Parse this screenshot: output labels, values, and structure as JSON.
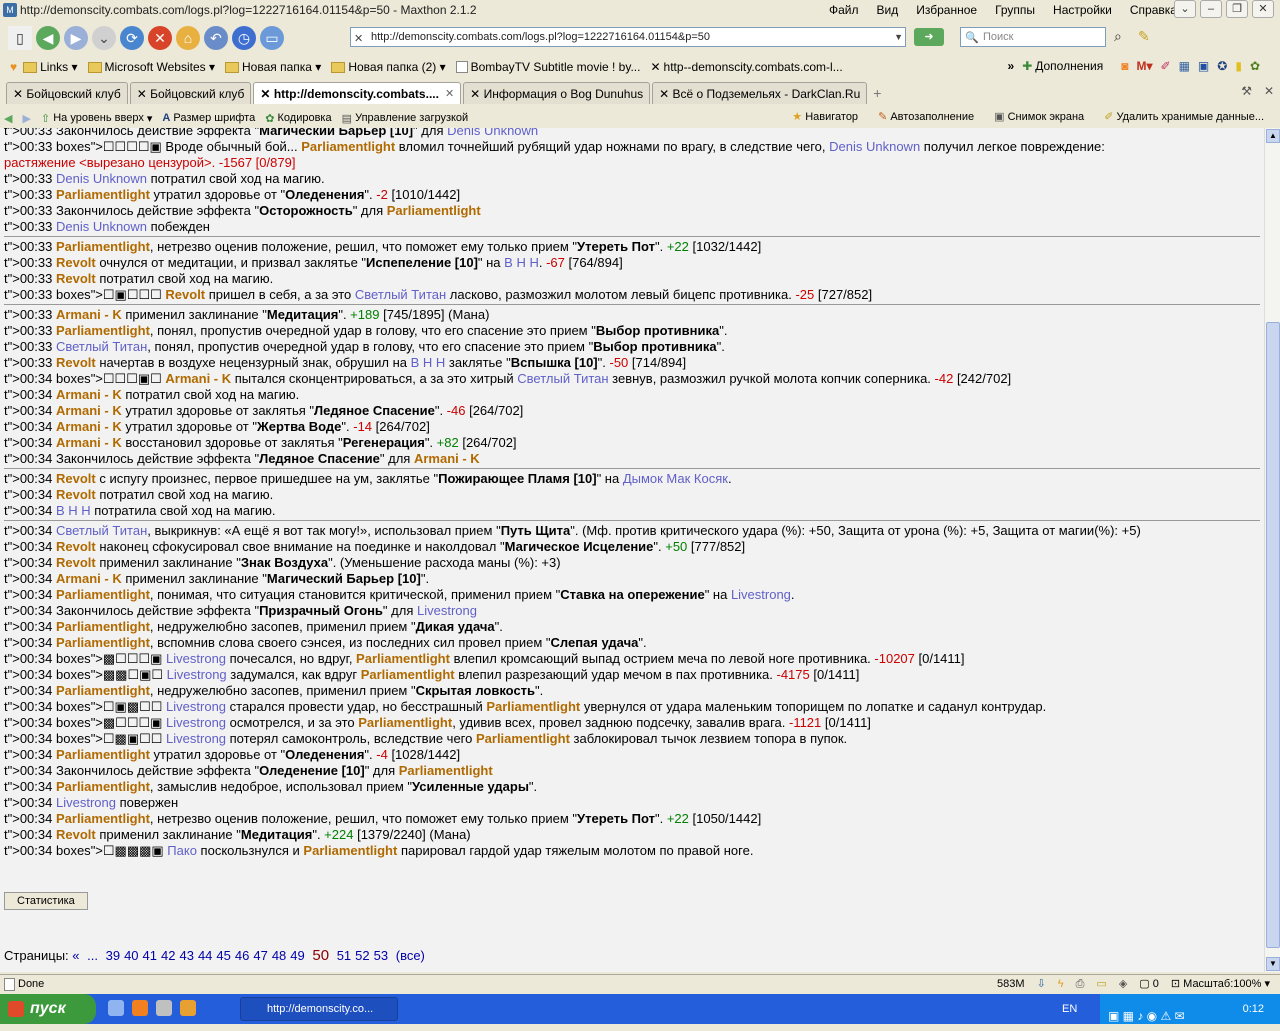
{
  "window": {
    "title": "http://demonscity.combats.com/logs.pl?log=1222716164.01154&p=50 - Maxthon 2.1.2"
  },
  "menu": [
    "Файл",
    "Вид",
    "Избранное",
    "Группы",
    "Настройки",
    "Справка"
  ],
  "address": {
    "url": "http://demonscity.combats.com/logs.pl?log=1222716164.01154&p=50"
  },
  "search": {
    "placeholder": "Поиск"
  },
  "links": [
    "Links",
    "Microsoft Websites",
    "Новая папка",
    "Новая папка (2)",
    "BombayTV  Subtitle movie !  by...",
    "http--demonscity.combats.com-l..."
  ],
  "links_right": "Дополнения",
  "tabs": [
    "Бойцовский клуб",
    "Бойцовский клуб",
    "http://demonscity.combats....",
    "Информация о Bog Dunuhus",
    "Всё о Подземельях - DarkClan.Ru"
  ],
  "toolbar2": [
    "На уровень вверх",
    "Размер шрифта",
    "Кодировка",
    "Управление загрузкой"
  ],
  "toolbar2_right": [
    "Навигатор",
    "Автозаполнение",
    "Снимок экрана",
    "Удалить хранимые данные..."
  ],
  "log_lines": [
    "00:33 Закончилось действие эффекта \"Магический Барьер [10]\" для Denis Unknown",
    "00:33 ☐☐☐☐▣ Вроде обычный бой... Parliamentlight вломил точнейший рубящий удар ножнами по врагу, в следствие чего, Denis Unknown получил легкое повреждение:",
    "растяжение <вырезано цензурой>. -1567 [0/879]",
    "00:33 Denis Unknown потратил свой ход на магию.",
    "00:33 Parliamentlight утратил здоровье от \"Оледенения\". -2 [1010/1442]",
    "00:33 Закончилось действие эффекта \"Осторожность\" для Parliamentlight",
    "00:33 Denis Unknown побежден",
    "00:33 Parliamentlight, нетрезво оценив положение, решил, что поможет ему только прием \"Утереть Пот\". +22 [1032/1442]",
    "00:33 Revolt очнулся от медитации, и призвал заклятье \"Испепеление [10]\" на В Н Н. -67 [764/894]",
    "00:33 Revolt потратил свой ход на магию.",
    "00:33 ☐▣☐☐☐ Revolt пришел в себя, а за это Светлый Титан ласково, размозжил молотом левый бицепс противника. -25 [727/852]",
    "00:33 Armani - K применил заклинание \"Медитация\". +189 [745/1895] (Мана)",
    "00:33 Parliamentlight, понял, пропустив очередной удар в голову, что его спасение это прием \"Выбор противника\".",
    "00:33 Светлый Титан, понял, пропустив очередной удар в голову, что его спасение это прием \"Выбор противника\".",
    "00:33 Revolt начертав в воздухе нецензурный знак, обрушил на В Н Н заклятье \"Вспышка [10]\". -50 [714/894]",
    "00:34 ☐☐☐▣☐ Armani - K пытался сконцентрироваться, а за это хитрый Светлый Титан зевнув, размозжил ручкой молота копчик соперника. -42 [242/702]",
    "00:34 Armani - K потратил свой ход на магию.",
    "00:34 Armani - K утратил здоровье от заклятья \"Ледяное Спасение\". -46 [264/702]",
    "00:34 Armani - K утратил здоровье от \"Жертва Воде\". -14 [264/702]",
    "00:34 Armani - K восстановил здоровье от заклятья \"Регенерация\". +82 [264/702]",
    "00:34 Закончилось действие эффекта \"Ледяное Спасение\" для Armani - K",
    "00:34 Revolt с испугу произнес, первое пришедшее на ум, заклятье \"Пожирающее Пламя [10]\" на Дымок Мак Косяк.",
    "00:34 Revolt потратил свой ход на магию.",
    "00:34 В Н Н потратила свой ход на магию.",
    "00:34 Светлый Титан, выкрикнув: «А ещё я вот так могу!», использовал прием \"Путь Щита\". (Мф. против критического удара (%): +50, Защита от урона (%): +5, Защита от магии(%): +5)",
    "00:34 Revolt наконец сфокусировал свое внимание на поединке и наколдовал \"Магическое Исцеление\". +50 [777/852]",
    "00:34 Revolt применил заклинание \"Знак Воздуха\". (Уменьшение расхода маны (%): +3)",
    "00:34 Armani - K применил заклинание \"Магический Барьер [10]\".",
    "00:34 Parliamentlight, понимая, что ситуация становится критической, применил прием \"Ставка на опережение\" на Livestrong.",
    "00:34 Закончилось действие эффекта \"Призрачный Огонь\" для Livestrong",
    "00:34 Parliamentlight, недружелюбно засопев, применил прием \"Дикая удача\".",
    "00:34 Parliamentlight, вспомнив слова своего сэнсея, из последних сил провел прием \"Слепая удача\".",
    "00:34 ▩☐☐☐▣ Livestrong почесался, но вдруг, Parliamentlight влепил кромсающий выпад острием меча по левой ноге противника. -10207 [0/1411]",
    "00:34 ▩▩☐▣☐ Livestrong задумался, как вдруг Parliamentlight влепил разрезающий удар мечом в пах противника. -4175 [0/1411]",
    "00:34 Parliamentlight, недружелюбно засопев, применил прием \"Скрытая ловкость\".",
    "00:34 ☐▣▩☐☐ Livestrong старался провести удар, но бесстрашный Parliamentlight увернулся от удара маленьким топорищем по лопатке и саданул контрудар.",
    "00:34 ▩☐☐☐▣ Livestrong осмотрелся, и за это Parliamentlight, удивив всех, провел заднюю подсечку, завалив врага. -1121 [0/1411]",
    "00:34 ☐▩▣☐☐ Livestrong потерял самоконтроль, вследствие чего Parliamentlight заблокировал тычок лезвием топора в пупок.",
    "00:34 Parliamentlight утратил здоровье от \"Оледенения\". -4 [1028/1442]",
    "00:34 Закончилось действие эффекта \"Оледенение [10]\" для Parliamentlight",
    "00:34 Parliamentlight, замыслив недоброе, использовал прием \"Усиленные удары\".",
    "00:34 Livestrong повержен",
    "00:34 Parliamentlight, нетрезво оценив положение, решил, что поможет ему только прием \"Утереть Пот\". +22 [1050/1442]",
    "00:34 Revolt применил заклинание \"Медитация\". +224 [1379/2240] (Мана)",
    "00:34 ☐▩▩▩▣ Пако поскользнулся и Parliamentlight парировал гардой удар тяжелым молотом по правой ноге."
  ],
  "stats_button": "Статистика",
  "pages": {
    "label": "Страницы:",
    "prev": "«",
    "dots": "...",
    "list": [
      "39",
      "40",
      "41",
      "42",
      "43",
      "44",
      "45",
      "46",
      "47",
      "48",
      "49"
    ],
    "current": "50",
    "after": [
      "51",
      "52",
      "53"
    ],
    "all": "(все)"
  },
  "status": {
    "text": "Done",
    "mem": "583M",
    "zoom": "Масштаб:100%",
    "count": "0"
  },
  "taskbar": {
    "start": "пуск",
    "task": "http://demonscity.co...",
    "lang": "EN",
    "time": "0:12"
  }
}
